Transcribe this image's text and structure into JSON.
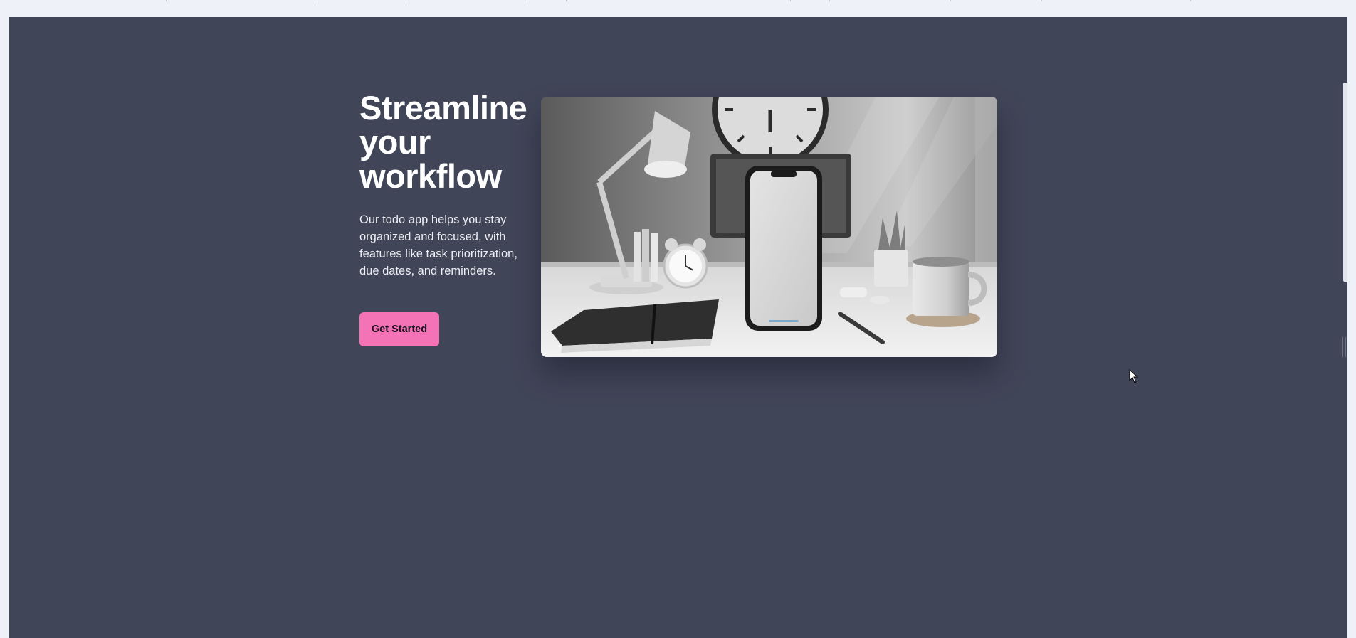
{
  "hero": {
    "title_lines": [
      "Streamline",
      "your",
      "workflow"
    ],
    "description": "Our todo app helps you stay organized and focused, with features like task prioritization, due dates, and reminders.",
    "cta_label": "Get Started"
  },
  "image": {
    "alt": "Workspace desk with smartphone, lamp, alarm clock, notebook and mug"
  },
  "colors": {
    "page_background": "#414558",
    "cta_background": "#f472b6",
    "title_text": "#ffffff"
  },
  "icons": [
    "mouse-cursor-icon"
  ]
}
